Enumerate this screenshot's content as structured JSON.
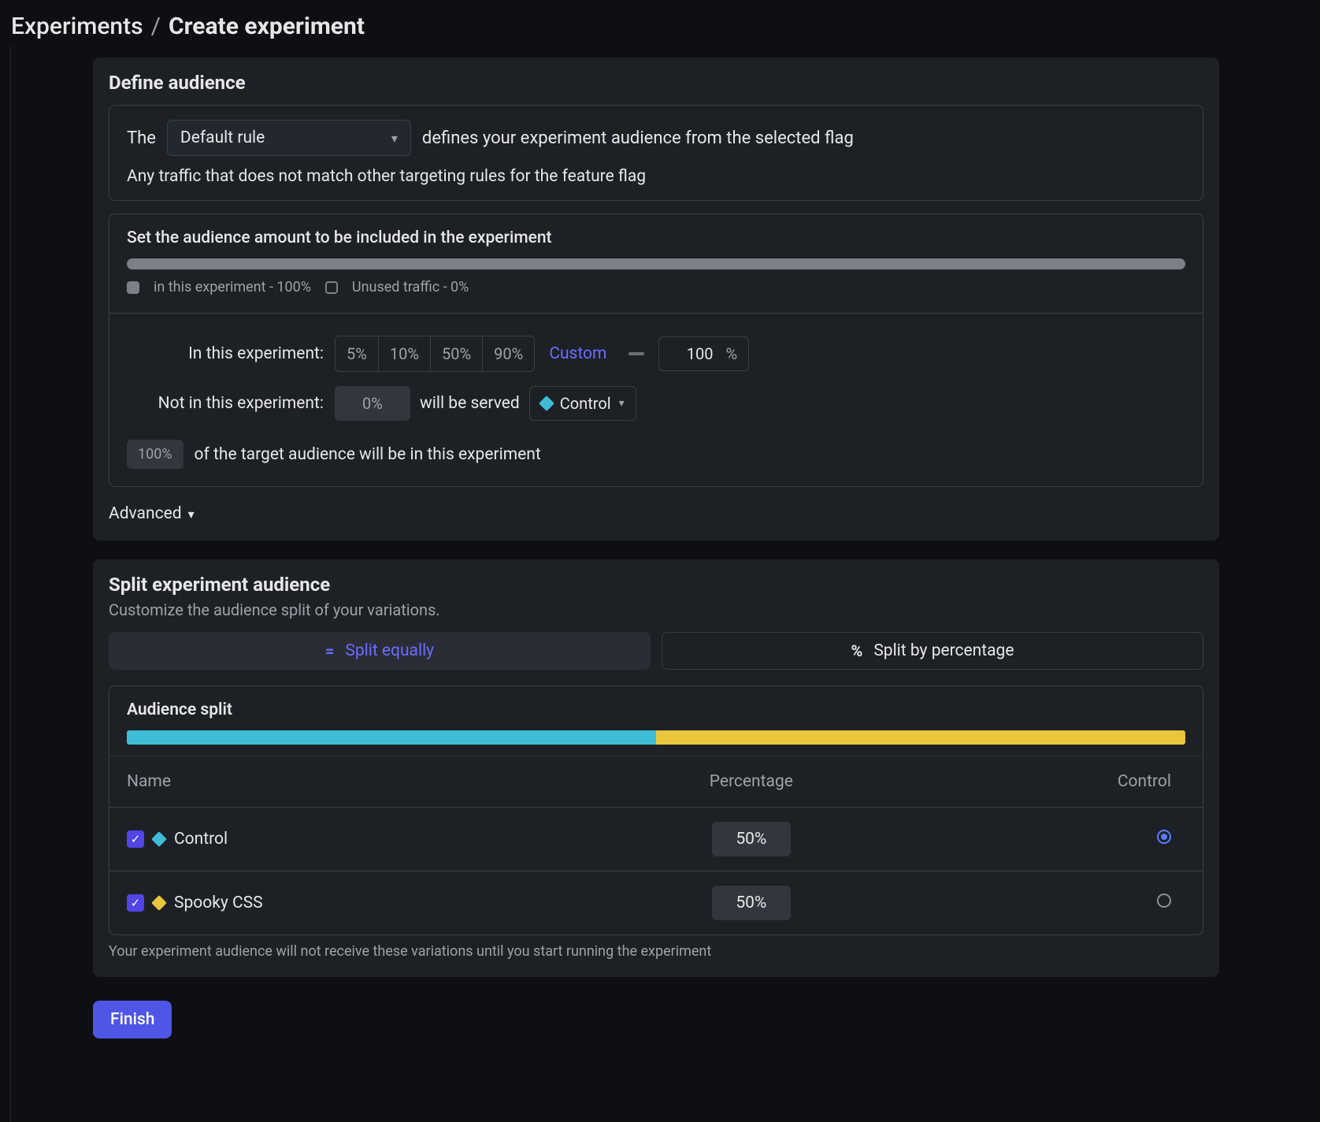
{
  "breadcrumb": {
    "root": "Experiments",
    "sep": "/",
    "current": "Create experiment"
  },
  "audience": {
    "title": "Define audience",
    "the_label": "The",
    "rule_selected": "Default rule",
    "defines_text": "defines your experiment audience from the selected flag",
    "description": "Any traffic that does not match other targeting rules for the feature flag",
    "set_amount_title": "Set the audience amount to be included in the experiment",
    "legend_in": "in this experiment - 100%",
    "legend_unused": "Unused traffic - 0%",
    "in_label": "In this experiment:",
    "not_in_label": "Not in this experiment:",
    "presets": [
      "5%",
      "10%",
      "50%",
      "90%"
    ],
    "custom_label": "Custom",
    "custom_value": "100",
    "unit": "%",
    "not_in_value": "0%",
    "will_be_served": "will be served",
    "served_variation": "Control",
    "summary_pct": "100%",
    "summary_text": "of the target audience will be in this experiment",
    "advanced_label": "Advanced"
  },
  "split": {
    "title": "Split experiment audience",
    "subtitle": "Customize the audience split of your variations.",
    "equal_label": "Split equally",
    "equal_sym": "=",
    "pct_label": "Split by percentage",
    "pct_sym": "%",
    "audience_split_label": "Audience split",
    "columns": {
      "name": "Name",
      "percentage": "Percentage",
      "control": "Control"
    },
    "rows": [
      {
        "name": "Control",
        "pct": "50%",
        "color": "cyan",
        "checked": true,
        "is_control": true
      },
      {
        "name": "Spooky CSS",
        "pct": "50%",
        "color": "yellow",
        "checked": true,
        "is_control": false
      }
    ],
    "footnote": "Your experiment audience will not receive these variations until you start running the experiment"
  },
  "finish_label": "Finish"
}
